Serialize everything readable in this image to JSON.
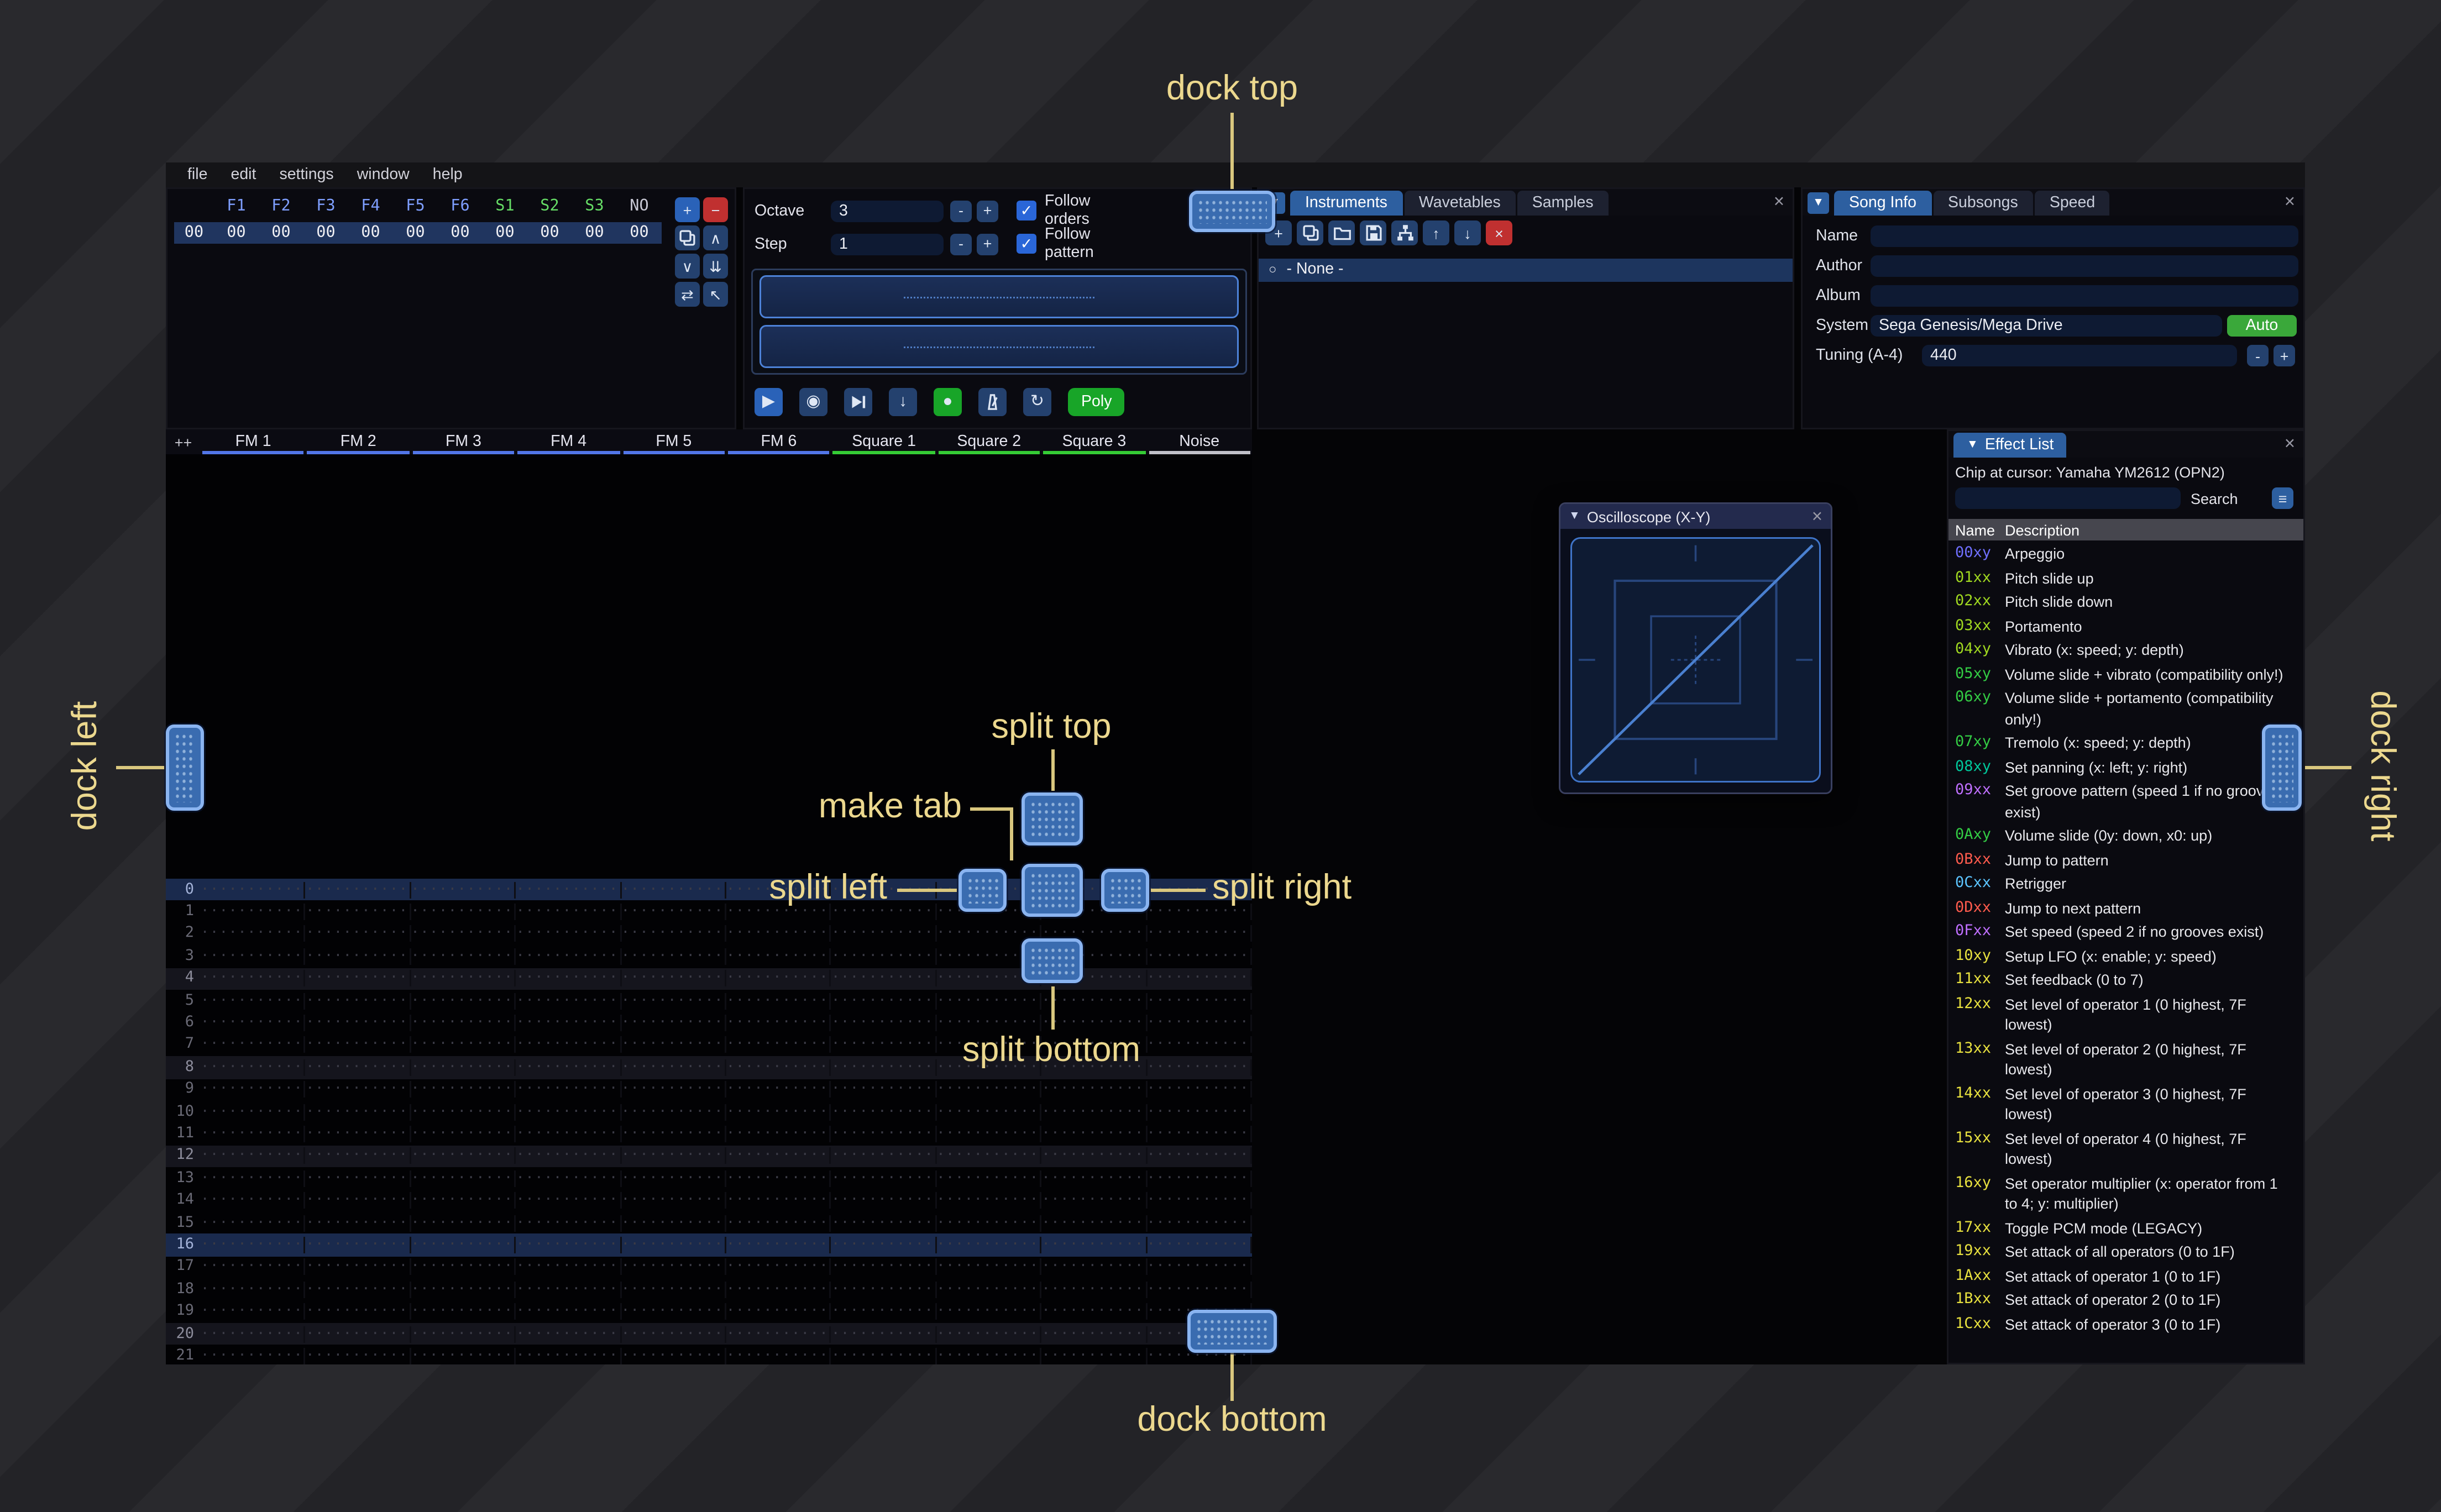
{
  "menu": {
    "items": [
      "file",
      "edit",
      "settings",
      "window",
      "help"
    ]
  },
  "orders": {
    "row_number": "00",
    "channels": [
      {
        "label": "F1",
        "type": "fm"
      },
      {
        "label": "F2",
        "type": "fm"
      },
      {
        "label": "F3",
        "type": "fm"
      },
      {
        "label": "F4",
        "type": "fm"
      },
      {
        "label": "F5",
        "type": "fm"
      },
      {
        "label": "F6",
        "type": "fm"
      },
      {
        "label": "S1",
        "type": "sq"
      },
      {
        "label": "S2",
        "type": "sq"
      },
      {
        "label": "S3",
        "type": "sq"
      },
      {
        "label": "NO",
        "type": "noise"
      }
    ],
    "row_values": [
      "00",
      "00",
      "00",
      "00",
      "00",
      "00",
      "00",
      "00",
      "00",
      "00"
    ],
    "buttons": [
      {
        "name": "add-order-button",
        "icon": "plus",
        "kind": "primary"
      },
      {
        "name": "remove-order-button",
        "icon": "minus",
        "kind": "danger"
      },
      {
        "name": "duplicate-order-button",
        "icon": "copy",
        "kind": "normal"
      },
      {
        "name": "move-order-up-button",
        "icon": "chevron-up",
        "kind": "normal"
      },
      {
        "name": "move-order-down-button",
        "icon": "chevron-down",
        "kind": "normal"
      },
      {
        "name": "duplicate-order-end-button",
        "icon": "double-down",
        "kind": "normal"
      },
      {
        "name": "order-change-mode-button",
        "icon": "swap",
        "kind": "normal"
      },
      {
        "name": "order-edit-mode-button",
        "icon": "pointer",
        "kind": "normal"
      }
    ]
  },
  "play_controls": {
    "octave_label": "Octave",
    "octave_value": "3",
    "step_label": "Step",
    "step_value": "1",
    "minus_label": "-",
    "plus_label": "+",
    "follow_orders_label": "Follow orders",
    "follow_pattern_label": "Follow pattern",
    "transport": [
      {
        "name": "play-button",
        "icon": "play",
        "kind": "primary"
      },
      {
        "name": "play-from-cursor-button",
        "icon": "circle-play",
        "kind": "normal"
      },
      {
        "name": "play-from-start-button",
        "icon": "skip",
        "kind": "normal"
      },
      {
        "name": "step-row-button",
        "icon": "arrow-down",
        "kind": "normal"
      },
      {
        "name": "edit-toggle-button",
        "icon": "record",
        "kind": "success"
      },
      {
        "name": "metronome-button",
        "icon": "metronome",
        "kind": "normal"
      },
      {
        "name": "repeat-pattern-button",
        "icon": "repeat",
        "kind": "normal"
      }
    ],
    "poly_label": "Poly"
  },
  "instruments": {
    "tabs": [
      {
        "label": "Instruments",
        "active": true
      },
      {
        "label": "Wavetables",
        "active": false
      },
      {
        "label": "Samples",
        "active": false
      }
    ],
    "toolbar": [
      {
        "name": "add-instrument-button",
        "icon": "plus",
        "kind": "normal"
      },
      {
        "name": "duplicate-instrument-button",
        "icon": "copy",
        "kind": "normal"
      },
      {
        "name": "open-instrument-button",
        "icon": "folder",
        "kind": "normal"
      },
      {
        "name": "save-instrument-button",
        "icon": "floppy",
        "kind": "normal"
      },
      {
        "name": "instrument-organize-button",
        "icon": "sitemap",
        "kind": "normal"
      },
      {
        "name": "instrument-up-button",
        "icon": "arrow-up",
        "kind": "normal"
      },
      {
        "name": "instrument-down-button",
        "icon": "arrow-down",
        "kind": "normal"
      },
      {
        "name": "delete-instrument-button",
        "icon": "cross",
        "kind": "danger"
      }
    ],
    "list": [
      {
        "label": "- None -",
        "selected": true
      }
    ]
  },
  "song_info": {
    "tabs": [
      {
        "label": "Song Info",
        "active": true
      },
      {
        "label": "Subsongs",
        "active": false
      },
      {
        "label": "Speed",
        "active": false
      }
    ],
    "fields": [
      {
        "label": "Name",
        "value": ""
      },
      {
        "label": "Author",
        "value": ""
      },
      {
        "label": "Album",
        "value": ""
      }
    ],
    "system_label": "System",
    "system_value": "Sega Genesis/Mega Drive",
    "auto_label": "Auto",
    "tuning_label": "Tuning (A-4)",
    "tuning_value": "440",
    "minus_label": "-",
    "plus_label": "+"
  },
  "pattern": {
    "corner_label": "++",
    "channels": [
      {
        "name": "FM 1",
        "type": "fm"
      },
      {
        "name": "FM 2",
        "type": "fm"
      },
      {
        "name": "FM 3",
        "type": "fm"
      },
      {
        "name": "FM 4",
        "type": "fm"
      },
      {
        "name": "FM 5",
        "type": "fm"
      },
      {
        "name": "FM 6",
        "type": "fm"
      },
      {
        "name": "Square 1",
        "type": "sq"
      },
      {
        "name": "Square 2",
        "type": "sq"
      },
      {
        "name": "Square 3",
        "type": "sq"
      },
      {
        "name": "Noise",
        "type": "noise"
      }
    ],
    "row_count": 22,
    "highlight_minor": 4,
    "highlight_major": 16,
    "empty_cell": "·············"
  },
  "oscilloscope": {
    "title": "Oscilloscope (X-Y)"
  },
  "effect_list": {
    "title": "Effect List",
    "chip_line": "Chip at cursor: Yamaha YM2612 (OPN2)",
    "search_label": "Search",
    "name_column": "Name",
    "description_column": "Description",
    "effects": [
      {
        "code": "00xy",
        "cat": "arpeggio",
        "desc": "Arpeggio"
      },
      {
        "code": "01xx",
        "cat": "pitch",
        "desc": "Pitch slide up"
      },
      {
        "code": "02xx",
        "cat": "pitch",
        "desc": "Pitch slide down"
      },
      {
        "code": "03xx",
        "cat": "pitch",
        "desc": "Portamento"
      },
      {
        "code": "04xy",
        "cat": "pitch",
        "desc": "Vibrato (x: speed; y: depth)"
      },
      {
        "code": "05xy",
        "cat": "volume",
        "desc": "Volume slide + vibrato (compatibility only!)"
      },
      {
        "code": "06xy",
        "cat": "volume",
        "desc": "Volume slide + portamento (compatibility only!)"
      },
      {
        "code": "07xy",
        "cat": "volume",
        "desc": "Tremolo (x: speed; y: depth)"
      },
      {
        "code": "08xy",
        "cat": "panning",
        "desc": "Set panning (x: left; y: right)"
      },
      {
        "code": "09xx",
        "cat": "speed",
        "desc": "Set groove pattern (speed 1 if no grooves exist)"
      },
      {
        "code": "0Axy",
        "cat": "volume",
        "desc": "Volume slide (0y: down, x0: up)"
      },
      {
        "code": "0Bxx",
        "cat": "jump",
        "desc": "Jump to pattern"
      },
      {
        "code": "0Cxx",
        "cat": "time",
        "desc": "Retrigger"
      },
      {
        "code": "0Dxx",
        "cat": "jump",
        "desc": "Jump to next pattern"
      },
      {
        "code": "0Fxx",
        "cat": "speed",
        "desc": "Set speed (speed 2 if no grooves exist)"
      },
      {
        "code": "10xy",
        "cat": "chip",
        "desc": "Setup LFO (x: enable; y: speed)"
      },
      {
        "code": "11xx",
        "cat": "chip",
        "desc": "Set feedback (0 to 7)"
      },
      {
        "code": "12xx",
        "cat": "chip",
        "desc": "Set level of operator 1 (0 highest, 7F lowest)"
      },
      {
        "code": "13xx",
        "cat": "chip",
        "desc": "Set level of operator 2 (0 highest, 7F lowest)"
      },
      {
        "code": "14xx",
        "cat": "chip",
        "desc": "Set level of operator 3 (0 highest, 7F lowest)"
      },
      {
        "code": "15xx",
        "cat": "chip",
        "desc": "Set level of operator 4 (0 highest, 7F lowest)"
      },
      {
        "code": "16xy",
        "cat": "chip",
        "desc": "Set operator multiplier (x: operator from 1 to 4; y: multiplier)"
      },
      {
        "code": "17xx",
        "cat": "chip",
        "desc": "Toggle PCM mode (LEGACY)"
      },
      {
        "code": "19xx",
        "cat": "chip",
        "desc": "Set attack of all operators (0 to 1F)"
      },
      {
        "code": "1Axx",
        "cat": "chip",
        "desc": "Set attack of operator 1 (0 to 1F)"
      },
      {
        "code": "1Bxx",
        "cat": "chip",
        "desc": "Set attack of operator 2 (0 to 1F)"
      },
      {
        "code": "1Cxx",
        "cat": "chip",
        "desc": "Set attack of operator 3 (0 to 1F)"
      }
    ]
  },
  "dock_labels": {
    "top": "dock top",
    "bottom": "dock bottom",
    "left": "dock left",
    "right": "dock right",
    "split_top": "split top",
    "split_bottom": "split bottom",
    "split_left": "split left",
    "split_right": "split right",
    "make_tab": "make tab"
  },
  "colors": {
    "accent": "#2d5fa0",
    "overlay_button": "#3a6cb0",
    "overlay_border": "#8ab4f0",
    "overlay_label": "#ecd88e",
    "auto_button": "#3aa83a",
    "poly_button": "#18a528",
    "fm_channel": "#5276e8",
    "square_channel": "#35cc35",
    "noise_channel": "#c0c0c8",
    "effect_categories": {
      "arpeggio": "#6f6fff",
      "pitch": "#a0d820",
      "volume": "#33cc44",
      "panning": "#00c89b",
      "speed": "#bf6fff",
      "jump": "#ff5b4d",
      "time": "#5cc4ff",
      "chip": "#e8e13f"
    }
  }
}
